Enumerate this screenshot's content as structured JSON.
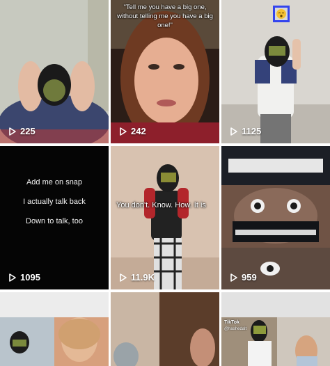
{
  "tiles": [
    {
      "count": "225"
    },
    {
      "count": "242",
      "caption": "\"Tell me you have a big one, without telling me you have a big one!\""
    },
    {
      "count": "1125",
      "face_icon": "pensive-face-emoji"
    },
    {
      "count": "1095",
      "lines": [
        "Add me on snap",
        "I actually talk back",
        "Down to talk, too"
      ]
    },
    {
      "count": "11.9K",
      "overlay": "You don't. Know. How. It is"
    },
    {
      "count": "959"
    },
    {},
    {},
    {
      "tag": "TikTok",
      "handle": "@hashedalt"
    }
  ],
  "icons": {
    "play": "play-icon",
    "face": "pensive-face-icon"
  },
  "colors": {
    "count_text": "#ffffff",
    "face_box_border": "#3344ee",
    "snap_bg": "#050505"
  }
}
